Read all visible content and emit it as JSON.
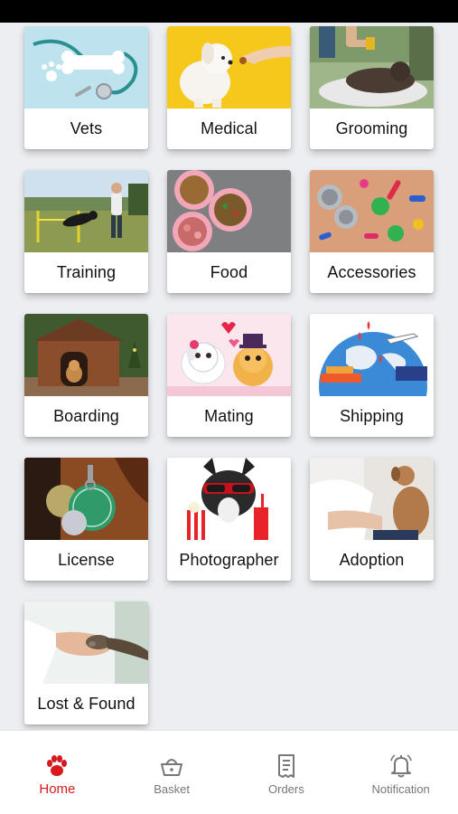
{
  "app": {
    "accent_color": "#d71920",
    "inactive_tab_color": "#777777"
  },
  "categories": [
    {
      "label": "Vets",
      "image": "stethoscope-bone-photo"
    },
    {
      "label": "Medical",
      "image": "white-puppy-treat-photo"
    },
    {
      "label": "Grooming",
      "image": "dog-grooming-photo"
    },
    {
      "label": "Training",
      "image": "dog-agility-training-photo"
    },
    {
      "label": "Food",
      "image": "pet-food-bowls-photo"
    },
    {
      "label": "Accessories",
      "image": "pet-accessories-photo"
    },
    {
      "label": "Boarding",
      "image": "dog-house-photo"
    },
    {
      "label": "Mating",
      "image": "cartoon-dogs-hearts-illustration"
    },
    {
      "label": "Shipping",
      "image": "pet-shipping-globe-illustration"
    },
    {
      "label": "License",
      "image": "dog-license-tags-photo"
    },
    {
      "label": "Photographer",
      "image": "bulldog-popcorn-photo"
    },
    {
      "label": "Adoption",
      "image": "dog-adoption-photo"
    },
    {
      "label": "Lost & Found",
      "image": "paw-in-hand-photo"
    }
  ],
  "tabbar": {
    "tabs": [
      {
        "label": "Home",
        "icon": "paw-icon",
        "active": true
      },
      {
        "label": "Basket",
        "icon": "basket-icon",
        "active": false
      },
      {
        "label": "Orders",
        "icon": "receipt-icon",
        "active": false
      },
      {
        "label": "Notification",
        "icon": "bell-icon",
        "active": false
      }
    ]
  }
}
